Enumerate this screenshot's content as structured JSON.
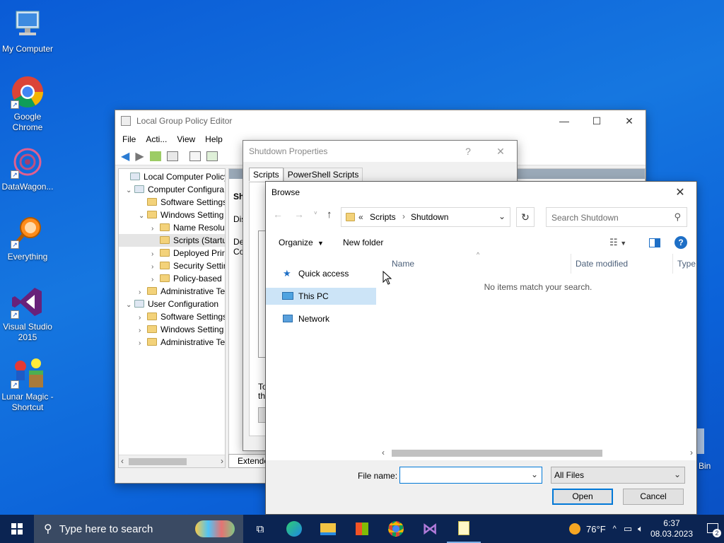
{
  "desktop": {
    "icons": [
      {
        "label": "My Computer"
      },
      {
        "label": "Google Chrome"
      },
      {
        "label": "DataWagon..."
      },
      {
        "label": "Everything"
      },
      {
        "label": "Visual Studio 2015"
      },
      {
        "label": "Lunar Magic - Shortcut"
      }
    ],
    "recycle_bin_partial": "Bin"
  },
  "gpe": {
    "title": "Local Group Policy Editor",
    "menu": [
      "File",
      "Acti...",
      "View",
      "Help"
    ],
    "tree": [
      {
        "label": "Local Computer Policy",
        "level": 0,
        "expand": ""
      },
      {
        "label": "Computer Configura",
        "level": 1,
        "expand": "v"
      },
      {
        "label": "Software Settings",
        "level": 2,
        "expand": ""
      },
      {
        "label": "Windows Setting",
        "level": 2,
        "expand": "v"
      },
      {
        "label": "Name Resoluti",
        "level": 3,
        "expand": ">"
      },
      {
        "label": "Scripts (Startu",
        "level": 3,
        "expand": ""
      },
      {
        "label": "Deployed Prir",
        "level": 3,
        "expand": ">"
      },
      {
        "label": "Security Settir",
        "level": 3,
        "expand": ">"
      },
      {
        "label": "Policy-based",
        "level": 3,
        "expand": ">"
      },
      {
        "label": "Administrative Te",
        "level": 2,
        "expand": ">"
      },
      {
        "label": "User Configuration",
        "level": 1,
        "expand": "v"
      },
      {
        "label": "Software Settings",
        "level": 2,
        "expand": ">"
      },
      {
        "label": "Windows Setting",
        "level": 2,
        "expand": ">"
      },
      {
        "label": "Administrative Te",
        "level": 2,
        "expand": ">"
      }
    ],
    "right_pane_partial": {
      "heading": "Shu",
      "text1": "Dis",
      "text2": "Des",
      "text3": "Co",
      "tab_label": "Extended"
    }
  },
  "shutdown_props": {
    "title": "Shutdown Properties",
    "help": "?",
    "tabs": [
      "Scripts",
      "PowerShell Scripts"
    ],
    "partial_text1": "To",
    "partial_text2": "the"
  },
  "browse": {
    "title": "Browse",
    "breadcrumb": {
      "prefix": "«",
      "items": [
        "Scripts",
        "Shutdown"
      ]
    },
    "search_placeholder": "Search Shutdown",
    "organize": "Organize",
    "new_folder": "New folder",
    "nav": [
      {
        "label": "Quick access",
        "icon": "star-icon"
      },
      {
        "label": "This PC",
        "icon": "pc-icon",
        "selected": true
      },
      {
        "label": "Network",
        "icon": "network-icon"
      }
    ],
    "columns": [
      "Name",
      "Date modified",
      "Type"
    ],
    "empty_message": "No items match your search.",
    "file_name_label": "File name:",
    "file_name_value": "",
    "filter": "All Files",
    "open_label": "Open",
    "cancel_label": "Cancel"
  },
  "taskbar": {
    "search_placeholder": "Type here to search",
    "weather": "76°F",
    "time": "6:37",
    "date": "08.03.2023",
    "notifications": "2"
  }
}
